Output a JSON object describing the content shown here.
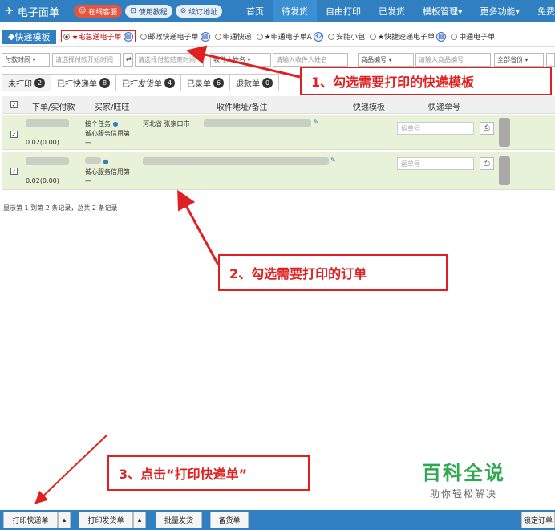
{
  "topnav": {
    "brand": "电子面单",
    "pills": [
      "在线客服",
      "使用教程",
      "续订地址"
    ],
    "items": [
      "首页",
      "待发货",
      "自由打印",
      "已发货",
      "模板管理▾",
      "更多功能▾",
      "免费"
    ]
  },
  "templates": {
    "label": "快递模板",
    "options": [
      {
        "text": "★宅急送电子单",
        "count": ""
      },
      {
        "text": "邮政快递电子单",
        "count": ""
      },
      {
        "text": "申通快递",
        "count": ""
      },
      {
        "text": "★申通电子单A",
        "count": "32"
      },
      {
        "text": "安能小包",
        "count": ""
      },
      {
        "text": "★快捷速递电子单",
        "count": ""
      },
      {
        "text": "中通电子单",
        "count": ""
      }
    ]
  },
  "filters": {
    "pay_time": "付款时间",
    "start_placeholder": "请选择付款开始时间",
    "end_placeholder": "请选择付款结束时间",
    "receiver_name_sel": "收件人姓名",
    "receiver_name_placeholder": "请输入收件人姓名",
    "product_code_sel": "商品编号",
    "product_code_placeholder": "请输入商品编号",
    "province": "全部省份"
  },
  "tabs": [
    {
      "label": "未打印",
      "count": "2"
    },
    {
      "label": "已打快递单",
      "count": "8"
    },
    {
      "label": "已打发货单",
      "count": "4"
    },
    {
      "label": "已录单",
      "count": "6"
    },
    {
      "label": "退款单",
      "count": "0"
    }
  ],
  "table": {
    "headers": [
      "下单/实付款",
      "买家/旺旺",
      "收件地址/备注",
      "快递模板",
      "快递单号"
    ],
    "rows": [
      {
        "amount": "0.02(0.00)",
        "buyer_line1": "接个任务",
        "buyer_line2": "诚心服务信用第",
        "buyer_line3": "一",
        "address": "河北省 张家口市",
        "waybill_placeholder": "运单号"
      },
      {
        "amount": "0.02(0.00)",
        "buyer_line1": "",
        "buyer_line2": "诚心服务信用第",
        "buyer_line3": "一",
        "address": "",
        "waybill_placeholder": "运单号"
      }
    ]
  },
  "records": "显示第 1 到第 2 条记录，总共 2 条记录",
  "callouts": {
    "c1": "1、勾选需要打印的快递模板",
    "c2": "2、勾选需要打印的订单",
    "c3": "3、点击“打印快递单”"
  },
  "bottom": {
    "print_express": "打印快递单",
    "print_delivery": "打印发货单",
    "batch_ship": "批量发货",
    "stock": "备货单",
    "lock": "锁定订单"
  },
  "watermark": {
    "title": "百科全说",
    "subtitle": "助你轻松解决"
  }
}
